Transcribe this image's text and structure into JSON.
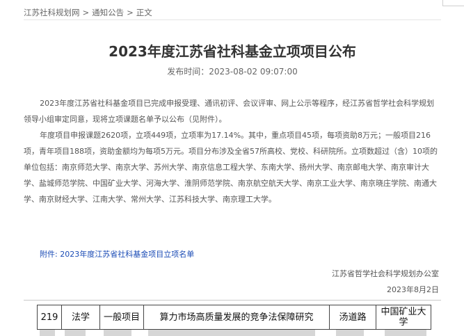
{
  "breadcrumb": {
    "items": [
      "江苏社科规划网",
      "通知公告",
      "正文"
    ],
    "separator": ">"
  },
  "article": {
    "title": "2023年度江苏省社科基金立项项目公布",
    "publish_time": "发布时间：2023-08-02 09:07:00",
    "paragraphs": [
      "2023年度江苏省社科基金项目已完成申报受理、通讯初评、会议评审、网上公示等程序，经江苏省哲学社会科学规划领导小组审定同意，现将立项课题名单予以公布（见附件）。",
      "年度项目申报课题2620项，立项449项，立项率为17.14%。其中，重点项目45项，每项资助8万元；一般项目216项，青年项目188项，资助金额均为每项5万元。项目分布涉及全省57所高校、党校、科研院所。立项数超过（含）10项的单位包括：南京师范大学、南京大学、苏州大学、南京信息工程大学、东南大学、扬州大学、南京邮电大学、南京审计大学、盐城师范学院、中国矿业大学、河海大学、淮阴师范学院、南京航空航天大学、南京工业大学、南京晓庄学院、南通大学、南京财经大学、江南大学、常州大学、江苏科技大学、南京理工大学。"
    ],
    "attachment_link": "附件: 2023年度江苏省社科基金项目立项名单",
    "signoff_org": "江苏省哲学社会科学规划办公室",
    "signoff_date": "2023年8月2日"
  },
  "table": {
    "rows": [
      {
        "no": "219",
        "subject": "法学",
        "type": "一般项目",
        "title": "算力市场高质量发展的竞争法保障研究",
        "leader": "汤道路",
        "unit": "中国矿业大学"
      }
    ]
  },
  "colors": {
    "link": "#1a4bb5",
    "text": "#555555",
    "title": "#333333"
  }
}
